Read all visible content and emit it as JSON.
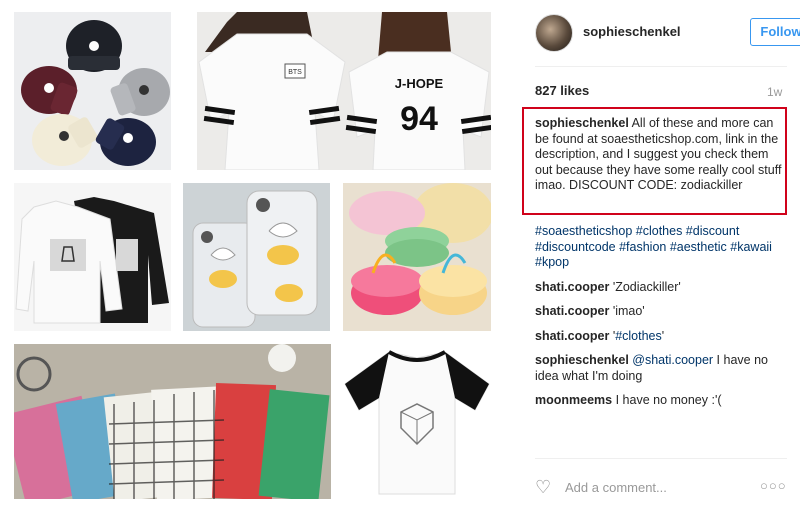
{
  "post": {
    "username": "sophieschenkel",
    "follow_label": "Follow",
    "likes": "827 likes",
    "time_ago": "1w",
    "caption_user": "sophieschenkel",
    "caption_text": "All of these and more can be found at soaestheticshop.com, link in the description, and I suggest you check them out because they have some really cool stuff imao. DISCOUNT CODE: zodiackiller",
    "hashtags": "#soaestheticshop #clothes #discount #discountcode #fashion #aesthetic #kawaii #kpop"
  },
  "comments": [
    {
      "user": "shati.cooper",
      "text": "'Zodiackiller'"
    },
    {
      "user": "shati.cooper",
      "text": "'imao'"
    },
    {
      "user": "shati.cooper",
      "text_pre": "'",
      "tag": "#clothes",
      "text_post": "'"
    },
    {
      "user": "sophieschenkel",
      "mention": "@shati.cooper",
      "text": " I have no idea what I'm doing"
    },
    {
      "user": "moonmeems",
      "text": "I have no money :'("
    }
  ],
  "add_comment_placeholder": "Add a comment...",
  "photo_labels": {
    "shirt_name": "J-HOPE",
    "shirt_number": "94",
    "bts_logo": "BTS"
  },
  "colors": {
    "accent": "#3897f0",
    "highlight_box": "#d0021b",
    "link": "#003569"
  }
}
